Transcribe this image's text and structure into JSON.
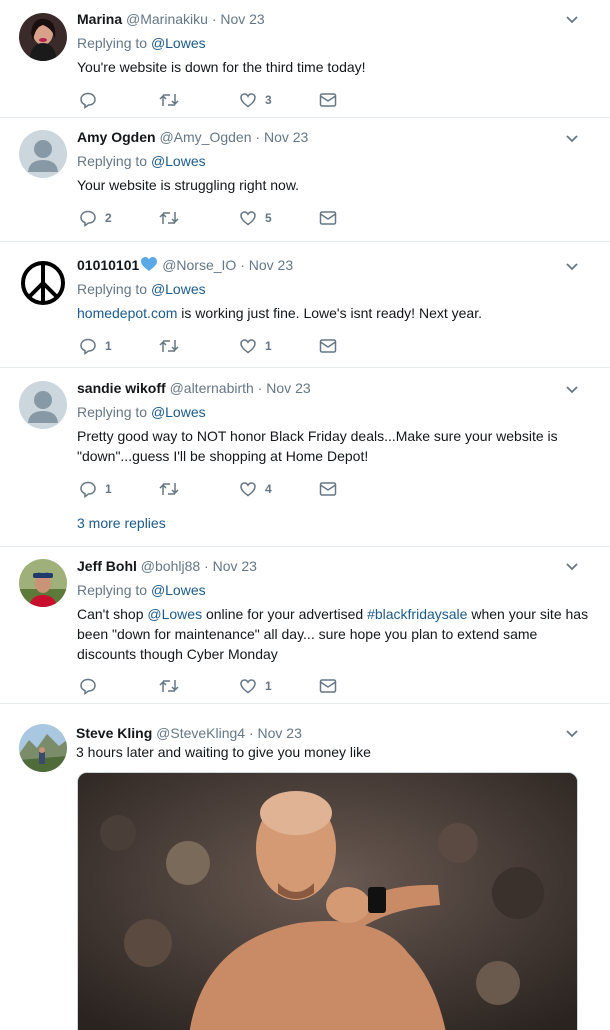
{
  "tweets": [
    {
      "name": "Marina",
      "handle": "@Marinakiku",
      "date": "· Nov 23",
      "replying_prefix": "Replying to ",
      "replying_to": "@Lowes",
      "text": "You're website is down for the third time today!",
      "counts": {
        "reply": "",
        "retweet": "",
        "like": "3"
      }
    },
    {
      "name": "Amy Ogden",
      "handle": "@Amy_Ogden",
      "date": "· Nov 23",
      "replying_prefix": "Replying to ",
      "replying_to": "@Lowes",
      "text": "Your website is struggling right now.",
      "counts": {
        "reply": "2",
        "retweet": "",
        "like": "5"
      }
    },
    {
      "name": "01010101",
      "handle": "@Norse_IO",
      "date": "· Nov 23",
      "replying_prefix": "Replying to ",
      "replying_to": "@Lowes",
      "text_link": "homedepot.com",
      "text": " is working just fine. Lowe's isnt ready! Next year.",
      "counts": {
        "reply": "1",
        "retweet": "",
        "like": "1"
      }
    },
    {
      "name": "sandie wikoff",
      "handle": "@alternabirth",
      "date": "· Nov 23",
      "replying_prefix": "Replying to ",
      "replying_to": "@Lowes",
      "text": "Pretty good way to NOT honor Black Friday deals...Make sure your website is \"down\"...guess I'll be shopping at Home Depot!",
      "counts": {
        "reply": "1",
        "retweet": "",
        "like": "4"
      },
      "more_replies": "3 more replies"
    },
    {
      "name": "Jeff Bohl",
      "handle": "@bohlj88",
      "date": "· Nov 23",
      "replying_prefix": "Replying to ",
      "replying_to": "@Lowes",
      "text_parts": [
        "Can't shop ",
        "@Lowes",
        " online for your advertised ",
        "#blackfridaysale",
        " when your site has been \"down for maintenance\" all day... sure hope you plan to extend same discounts though Cyber Monday"
      ],
      "counts": {
        "reply": "",
        "retweet": "",
        "like": "1"
      }
    },
    {
      "name": "Steve Kling",
      "handle": "@SteveKling4",
      "date": "· Nov 23",
      "text": "3 hours later and waiting to give you money like"
    }
  ],
  "colors": {
    "link": "#1b5a8c",
    "meta": "#657786",
    "heart_badge": "#5aa9e6"
  }
}
